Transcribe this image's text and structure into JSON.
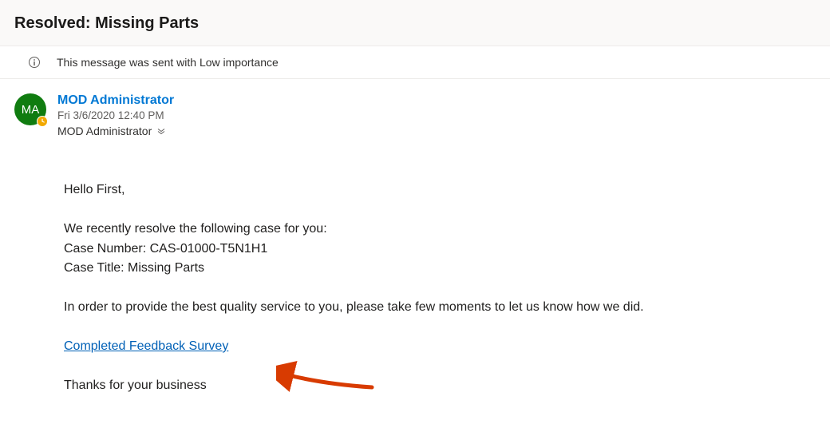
{
  "header": {
    "subject": "Resolved: Missing Parts"
  },
  "importance": {
    "message": "This message was sent with Low importance"
  },
  "sender": {
    "initials": "MA",
    "name": "MOD Administrator",
    "date": "Fri 3/6/2020 12:40 PM",
    "recipient": "MOD Administrator"
  },
  "body": {
    "greeting": "Hello First,",
    "intro": "We recently resolve the following case for you:",
    "case_number": "Case Number: CAS-01000-T5N1H1",
    "case_title": "Case Title: Missing Parts",
    "cta_intro": "In order to provide the best quality service to you, please take few moments to let us know how we did.",
    "survey_link": "Completed Feedback Survey",
    "closing": "Thanks for your business"
  }
}
